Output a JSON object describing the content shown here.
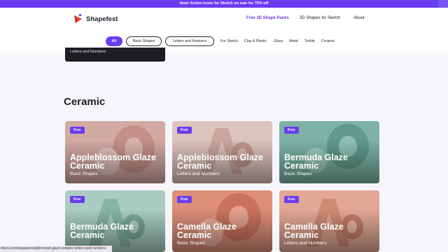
{
  "announcement": "Now! Action Icons for Sketch on sale for 75% off",
  "brand": {
    "name": "Shapefest",
    "accent": "#6a3cf0",
    "logo_color": "#ee4035"
  },
  "nav": {
    "items": [
      {
        "label": "Free 3D Shape Packs",
        "active": true
      },
      {
        "label": "3D Shapes for Sketch",
        "active": false
      },
      {
        "label": "About",
        "active": false
      }
    ]
  },
  "filters": {
    "pills": [
      "All",
      "Basic Shapes",
      "Letters and Numbers"
    ],
    "links": [
      "For Sketch",
      "Clay & Plastic",
      "Glass",
      "Metal",
      "Textile",
      "Ceramic"
    ]
  },
  "previous_card": {
    "subtitle": "Letters and Numbers"
  },
  "section": {
    "title": "Ceramic"
  },
  "cards": [
    {
      "badge": "Free",
      "title_line1": "Appleblossom Glaze",
      "title_line2": "Ceramic",
      "subtitle": "Basic Shapes",
      "color": "#d3a9a3",
      "icon": "ring-shape"
    },
    {
      "badge": "Free",
      "title_line1": "Appleblossom Glaze",
      "title_line2": "Ceramic",
      "subtitle": "Letters and Numbers",
      "color": "#dcc3bd",
      "icon": "letters-aa"
    },
    {
      "badge": "Free",
      "title_line1": "Bermuda Glaze",
      "title_line2": "Ceramic",
      "subtitle": "Basic Shapes",
      "color": "#7db3a4",
      "icon": "ring-shape"
    },
    {
      "badge": "Free",
      "title_line1": "Bermuda Glaze",
      "title_line2": "Ceramic",
      "subtitle": "",
      "color": "#a9cdc2",
      "icon": "letters-aa"
    },
    {
      "badge": "Free",
      "title_line1": "Camella Glaze",
      "title_line2": "Ceramic",
      "subtitle": "Basic Shapes",
      "color": "#dc8e78",
      "icon": "ring-shape"
    },
    {
      "badge": "Free",
      "title_line1": "Camella Glaze",
      "title_line2": "Ceramic",
      "subtitle": "Letters and Numbers",
      "color": "#e2a795",
      "icon": "letters-aa"
    }
  ],
  "status_url": "efest.com/expansions/glenwood-glaze-ceramic-letters-and-numbers"
}
